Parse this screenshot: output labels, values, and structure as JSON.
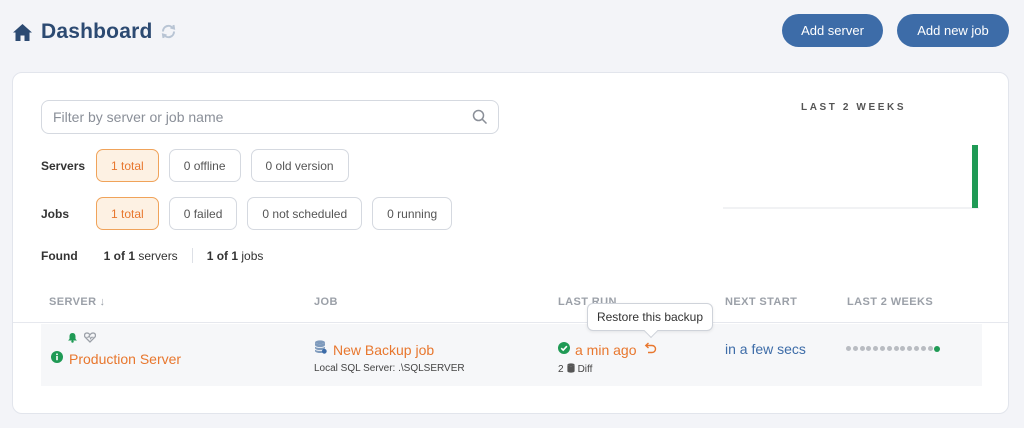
{
  "header": {
    "title": "Dashboard",
    "add_server_label": "Add server",
    "add_job_label": "Add new job"
  },
  "search": {
    "placeholder": "Filter by server or job name"
  },
  "filters": {
    "servers_label": "Servers",
    "servers": [
      "1 total",
      "0 offline",
      "0 old version"
    ],
    "jobs_label": "Jobs",
    "jobs": [
      "1 total",
      "0 failed",
      "0 not scheduled",
      "0 running"
    ]
  },
  "found": {
    "label": "Found",
    "servers_count": "1 of 1",
    "servers_suffix": "servers",
    "jobs_count": "1 of 1",
    "jobs_suffix": "jobs"
  },
  "chart": {
    "title": "LAST 2 WEEKS",
    "bar_color": "#1f9a55",
    "daily_success": [
      0,
      0,
      0,
      0,
      0,
      0,
      0,
      0,
      0,
      0,
      0,
      0,
      0,
      1
    ]
  },
  "table": {
    "headers": {
      "server": "SERVER",
      "job": "JOB",
      "last_run": "LAST RUN",
      "next_start": "NEXT START",
      "last_2_weeks": "LAST 2 WEEKS"
    },
    "rows": [
      {
        "server": "Production Server",
        "job": "New Backup job",
        "job_target": "Local SQL Server: .\\SQLSERVER",
        "last_run": "a min ago",
        "last_run_sub": "2",
        "last_run_type": "Diff",
        "next_start": "in a few secs",
        "history": [
          "none",
          "none",
          "none",
          "none",
          "none",
          "none",
          "none",
          "none",
          "none",
          "none",
          "none",
          "none",
          "none",
          "ok"
        ]
      }
    ]
  },
  "tooltip": "Restore this backup",
  "colors": {
    "primary": "#3d6ca8",
    "accent": "#e8772e",
    "success": "#1f9a55",
    "title": "#2c4a72"
  }
}
